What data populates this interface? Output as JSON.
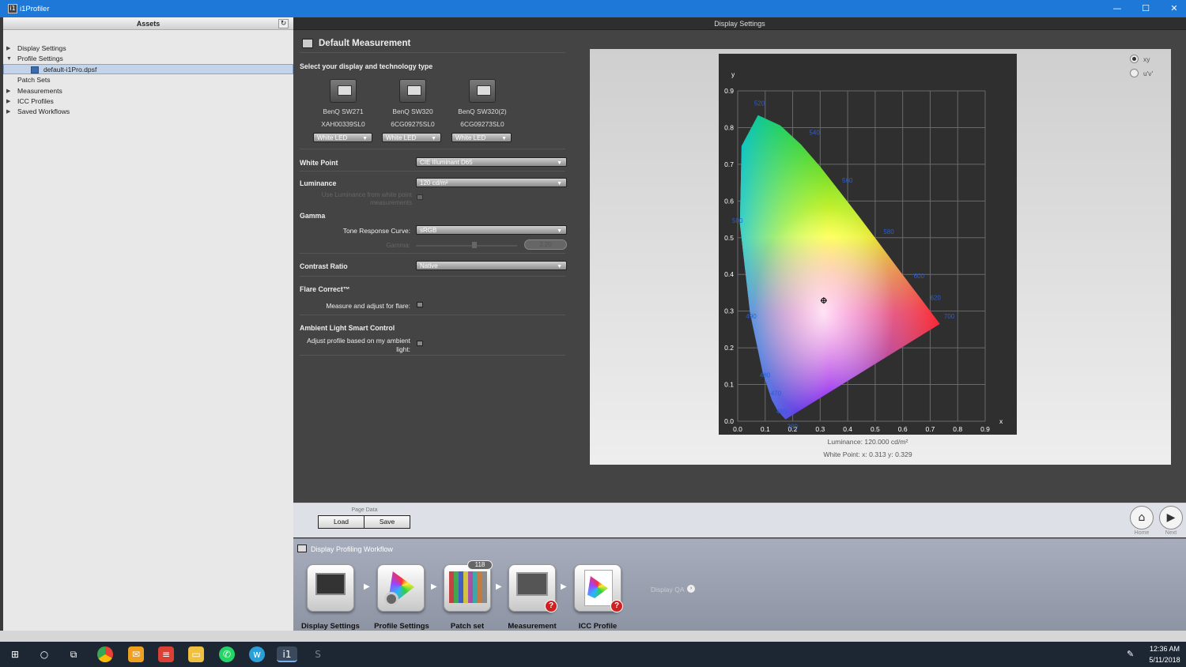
{
  "window": {
    "title": "i1Profiler",
    "minimize": "—",
    "maximize": "☐",
    "close": "✕"
  },
  "assets": {
    "header": "Assets",
    "refresh": "↻",
    "tree": [
      {
        "label": "Display Settings",
        "expanded": false
      },
      {
        "label": "Profile Settings",
        "expanded": true
      },
      {
        "label": "default-i1Pro.dpsf",
        "selected": true
      },
      {
        "label": "Patch Sets"
      },
      {
        "label": "Measurements",
        "expanded": false
      },
      {
        "label": "ICC Profiles",
        "expanded": false
      },
      {
        "label": "Saved Workflows",
        "expanded": false
      }
    ]
  },
  "panel": {
    "header": "Display Settings",
    "section_title": "Default Measurement",
    "select_display": "Select your display and technology type",
    "displays": [
      {
        "name": "BenQ SW271",
        "serial": "XAH00339SL0",
        "tech": "White LED"
      },
      {
        "name": "BenQ SW320",
        "serial": "6CG09275SL0",
        "tech": "White LED"
      },
      {
        "name": "BenQ SW320(2)",
        "serial": "6CG09273SL0",
        "tech": "White LED"
      }
    ],
    "white_point": {
      "label": "White Point",
      "value": "CIE Illuminant D65"
    },
    "luminance": {
      "label": "Luminance",
      "value": "120 cd/m²",
      "hint": "Use Luminance from white point measurements"
    },
    "gamma": {
      "label": "Gamma",
      "trc_label": "Tone Response Curve:",
      "trc_value": "sRGB",
      "gamma_label": "Gamma:",
      "gamma_value": "2.20"
    },
    "contrast": {
      "label": "Contrast Ratio",
      "value": "Native"
    },
    "flare": {
      "label": "Flare Correct™",
      "option": "Measure and adjust for flare:"
    },
    "ambient": {
      "label": "Ambient Light Smart Control",
      "option_line1": "Adjust profile based on my ambient",
      "option_line2": "light:"
    }
  },
  "chart": {
    "radio_xy": "xy",
    "radio_uv": "u'v'",
    "luminance_text": "Luminance: 120.000 cd/m²",
    "whitepoint_text": "White Point: x: 0.313  y: 0.329"
  },
  "chart_data": {
    "type": "scatter",
    "title": "",
    "xlabel": "x",
    "ylabel": "y",
    "xlim": [
      0.0,
      0.9
    ],
    "ylim": [
      0.0,
      0.9
    ],
    "xticks": [
      "0.0",
      "0.1",
      "0.2",
      "0.3",
      "0.4",
      "0.5",
      "0.6",
      "0.7",
      "0.8",
      "0.9"
    ],
    "yticks": [
      "0.0",
      "0.1",
      "0.2",
      "0.3",
      "0.4",
      "0.5",
      "0.6",
      "0.7",
      "0.8",
      "0.9"
    ],
    "grid": true,
    "white_point": {
      "x": 0.313,
      "y": 0.329
    },
    "wavelength_labels": [
      {
        "nm": "380",
        "x": 0.18,
        "y": -0.02
      },
      {
        "nm": "460",
        "x": 0.14,
        "y": 0.02
      },
      {
        "nm": "470",
        "x": 0.12,
        "y": 0.07
      },
      {
        "nm": "480",
        "x": 0.08,
        "y": 0.12
      },
      {
        "nm": "490",
        "x": 0.03,
        "y": 0.28
      },
      {
        "nm": "500",
        "x": -0.02,
        "y": 0.54
      },
      {
        "nm": "520",
        "x": 0.06,
        "y": 0.86
      },
      {
        "nm": "540",
        "x": 0.26,
        "y": 0.78
      },
      {
        "nm": "560",
        "x": 0.38,
        "y": 0.65
      },
      {
        "nm": "580",
        "x": 0.53,
        "y": 0.51
      },
      {
        "nm": "600",
        "x": 0.64,
        "y": 0.39
      },
      {
        "nm": "620",
        "x": 0.7,
        "y": 0.33
      },
      {
        "nm": "700",
        "x": 0.75,
        "y": 0.28
      }
    ]
  },
  "bottom": {
    "page_data": "Page Data",
    "load": "Load",
    "save": "Save",
    "home": "Home",
    "next": "Next"
  },
  "workflow": {
    "title": "Display Profiling Workflow",
    "steps": [
      "Display Settings",
      "Profile Settings",
      "Patch set",
      "Measurement",
      "ICC Profile"
    ],
    "patch_count": "118",
    "qa": "Display QA"
  },
  "taskbar": {
    "time": "12:36 AM",
    "date": "5/11/2018"
  }
}
